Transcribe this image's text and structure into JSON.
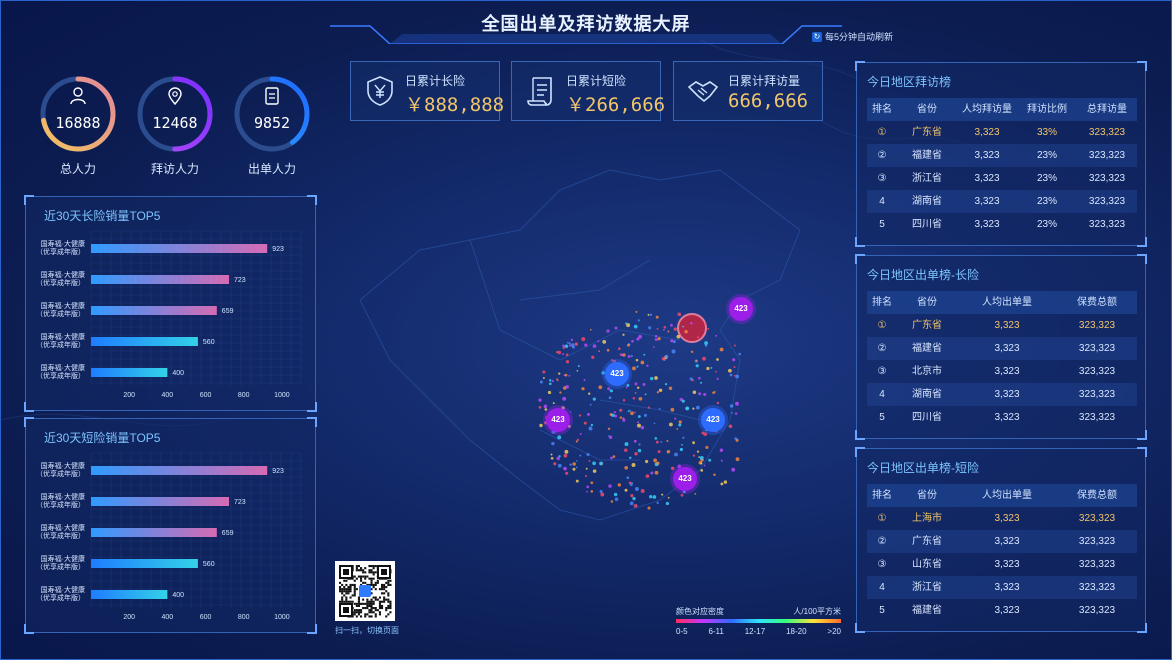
{
  "header": {
    "title": "全国出单及拜访数据大屏",
    "refresh_label": "每5分钟自动刷新"
  },
  "gauges": [
    {
      "label": "总人力",
      "value": "16888",
      "icon": "person-icon",
      "ratio": 0.72
    },
    {
      "label": "拜访人力",
      "value": "12468",
      "icon": "location-person-icon",
      "ratio": 0.5
    },
    {
      "label": "出单人力",
      "value": "9852",
      "icon": "document-icon",
      "ratio": 0.4
    }
  ],
  "stats": [
    {
      "label": "日累计长险",
      "value": "￥888,888",
      "icon": "shield-yen-icon"
    },
    {
      "label": "日累计短险",
      "value": "￥266,666",
      "icon": "scroll-icon"
    },
    {
      "label": "日累计拜访量",
      "value": "666,666",
      "icon": "handshake-icon"
    }
  ],
  "long_top5": {
    "title": "近30天长险销量TOP5",
    "chart_data": {
      "type": "bar",
      "orientation": "horizontal",
      "categories": [
        "国寿福·大健康（优享成年版）",
        "国寿福·大健康（优享成年版）",
        "国寿福·大健康（优享成年版）",
        "国寿福·大健康（优享成年版）",
        "国寿福·大健康（优享成年版）"
      ],
      "values": [
        923,
        723,
        659,
        560,
        400
      ],
      "xlim": [
        0,
        1100
      ],
      "ticks": [
        200,
        400,
        600,
        800,
        1000
      ]
    }
  },
  "short_top5": {
    "title": "近30天短险销量TOP5",
    "chart_data": {
      "type": "bar",
      "orientation": "horizontal",
      "categories": [
        "国寿福·大健康（优享成年版）",
        "国寿福·大健康（优享成年版）",
        "国寿福·大健康（优享成年版）",
        "国寿福·大健康（优享成年版）",
        "国寿福·大健康（优享成年版）"
      ],
      "values": [
        923,
        723,
        659,
        560,
        400
      ],
      "xlim": [
        0,
        1100
      ],
      "ticks": [
        200,
        400,
        600,
        800,
        1000
      ]
    }
  },
  "rank_visit": {
    "title": "今日地区拜访榜",
    "headers": [
      "排名",
      "省份",
      "人均拜访量",
      "拜访比例",
      "总拜访量"
    ],
    "rows": [
      [
        "①",
        "广东省",
        "3,323",
        "33%",
        "323,323"
      ],
      [
        "②",
        "福建省",
        "3,323",
        "23%",
        "323,323"
      ],
      [
        "③",
        "浙江省",
        "3,323",
        "23%",
        "323,323"
      ],
      [
        "4",
        "湖南省",
        "3,323",
        "23%",
        "323,323"
      ],
      [
        "5",
        "四川省",
        "3,323",
        "23%",
        "323,323"
      ]
    ]
  },
  "rank_long": {
    "title": "今日地区出单榜-长险",
    "headers": [
      "排名",
      "省份",
      "人均出单量",
      "保费总额"
    ],
    "rows": [
      [
        "①",
        "广东省",
        "3,323",
        "323,323"
      ],
      [
        "②",
        "福建省",
        "3,323",
        "323,323"
      ],
      [
        "③",
        "北京市",
        "3,323",
        "323,323"
      ],
      [
        "4",
        "湖南省",
        "3,323",
        "323,323"
      ],
      [
        "5",
        "四川省",
        "3,323",
        "323,323"
      ]
    ]
  },
  "rank_short": {
    "title": "今日地区出单榜-短险",
    "headers": [
      "排名",
      "省份",
      "人均出单量",
      "保费总额"
    ],
    "rows": [
      [
        "①",
        "上海市",
        "3,323",
        "323,323"
      ],
      [
        "②",
        "广东省",
        "3,323",
        "323,323"
      ],
      [
        "③",
        "山东省",
        "3,323",
        "323,323"
      ],
      [
        "4",
        "浙江省",
        "3,323",
        "323,323"
      ],
      [
        "5",
        "福建省",
        "3,323",
        "323,323"
      ]
    ]
  },
  "map": {
    "bubbles": [
      "423",
      "423",
      "423",
      "423",
      "423"
    ],
    "qr_label": "扫一扫，切换页面",
    "legend_title": "颜色对应密度",
    "legend_unit": "人/100平方米",
    "legend_ticks": [
      "0-5",
      "6-11",
      "12-17",
      "18-20",
      ">20"
    ],
    "colors": {
      "bubble_blue": "#2e6bff",
      "bubble_purple": "#9b1fe8",
      "hot": "#e0284d"
    }
  }
}
